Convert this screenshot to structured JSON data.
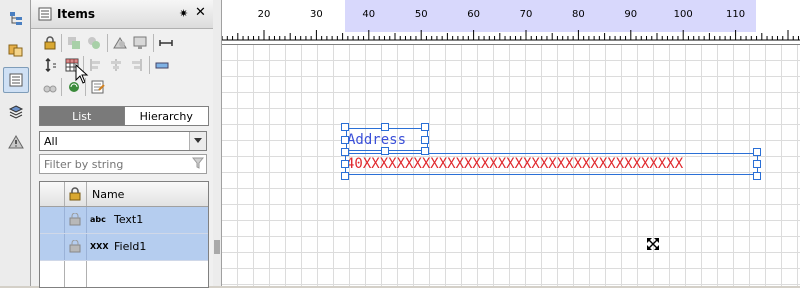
{
  "panel": {
    "title": "Items",
    "tabs": [
      "List",
      "Hierarchy"
    ],
    "selected_tab": "List",
    "dropdown_value": "All",
    "filter_placeholder": "Filter by string",
    "grid_header": "Name",
    "rows": [
      {
        "type_icon": "abc",
        "name": "Text1"
      },
      {
        "type_icon": "XXX",
        "name": "Field1"
      }
    ]
  },
  "ruler": {
    "labels": [
      "20",
      "30",
      "40",
      "50",
      "60",
      "70",
      "80",
      "90",
      "100",
      "110"
    ]
  },
  "canvas": {
    "text_label": "Address",
    "field_value": "40XXXXXXXXXXXXXXXXXXXXXXXXXXXXXXXXXXXXXX",
    "text_color": "#3a4fd8",
    "field_color": "#e0282d"
  },
  "colors": {
    "ruler_highlight": "#d8d8fc",
    "selection_handle": "#2a6fd6",
    "row_selected": "#b5cdef"
  }
}
